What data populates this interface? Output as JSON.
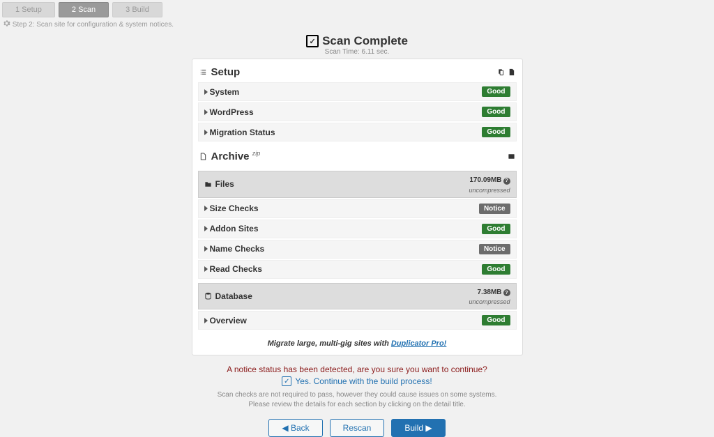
{
  "wizard": {
    "steps": [
      "1 Setup",
      "2 Scan",
      "3 Build"
    ],
    "active": 1,
    "subtitle": "Step 2: Scan site for configuration & system notices."
  },
  "header": {
    "title": "Scan Complete",
    "scan_time": "Scan Time: 6.11 sec."
  },
  "setup": {
    "title": "Setup",
    "rows": [
      {
        "label": "System",
        "status": "Good"
      },
      {
        "label": "WordPress",
        "status": "Good"
      },
      {
        "label": "Migration Status",
        "status": "Good"
      }
    ]
  },
  "archive": {
    "title": "Archive",
    "suffix": "zip",
    "files": {
      "title": "Files",
      "size": "170.09MB",
      "note": "uncompressed",
      "rows": [
        {
          "label": "Size Checks",
          "status": "Notice"
        },
        {
          "label": "Addon Sites",
          "status": "Good"
        },
        {
          "label": "Name Checks",
          "status": "Notice"
        },
        {
          "label": "Read Checks",
          "status": "Good"
        }
      ]
    },
    "database": {
      "title": "Database",
      "size": "7.38MB",
      "note": "uncompressed",
      "rows": [
        {
          "label": "Overview",
          "status": "Good"
        }
      ]
    }
  },
  "promo": {
    "text": "Migrate large, multi-gig sites with ",
    "link": "Duplicator Pro!"
  },
  "footer": {
    "warn": "A notice status has been detected, are you sure you want to continue?",
    "confirm": "Yes. Continue with the build process!",
    "help1": "Scan checks are not required to pass, however they could cause issues on some systems.",
    "help2": "Please review the details for each section by clicking on the detail title.",
    "back": "Back",
    "rescan": "Rescan",
    "build": "Build"
  }
}
